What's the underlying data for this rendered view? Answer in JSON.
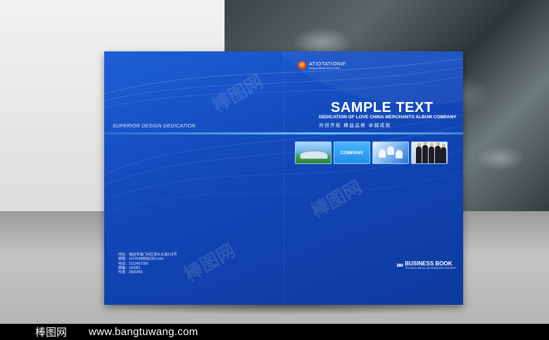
{
  "cover": {
    "logo_text": "ATIOTATIONIF",
    "logo_sub": "being professional for brand",
    "tagline": "SUPERIOR DESIGN DEDICATION",
    "title": "SAMPLE TEXT",
    "subtitle": "DEDICATION OF LOVE CHINA MERCHANTS ALBUM COMPANY",
    "subtitle_cn": "共创开拓 精益品质 卓越成就",
    "tiles": [
      {
        "label": ""
      },
      {
        "label": "COMPANY"
      },
      {
        "label": ""
      },
      {
        "label": ""
      }
    ],
    "contact": [
      "地址：海迪市海门州区滨水大道210号",
      "邮箱：141414888@163.com",
      "电话：3112407250",
      "邮编：110001",
      "传真：2666456"
    ],
    "business_book": {
      "arrows": "»»",
      "title": "BUSINESS BOOK",
      "sub": "TECHNOLOGICAL INFORMATION CONTENT"
    },
    "watermark": "棒图网"
  },
  "footer": {
    "brand": "棒图网",
    "url": "www.bangtuwang.com"
  },
  "colors": {
    "cover_blue": "#1247b8",
    "accent_cyan": "#6cc3ff",
    "footer_bg": "#000000"
  }
}
